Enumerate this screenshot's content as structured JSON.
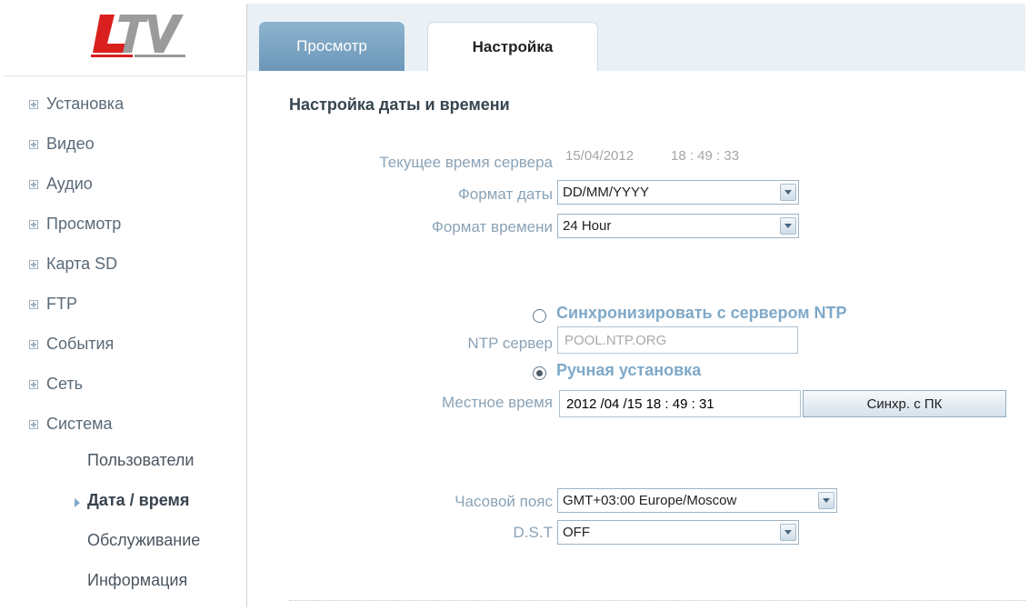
{
  "logo": {
    "text": "LTV"
  },
  "tabs": [
    {
      "label": "Просмотр"
    },
    {
      "label": "Настройка"
    }
  ],
  "sidebar": {
    "items": [
      {
        "label": "Установка"
      },
      {
        "label": "Видео"
      },
      {
        "label": "Аудио"
      },
      {
        "label": "Просмотр"
      },
      {
        "label": "Карта SD"
      },
      {
        "label": "FTP"
      },
      {
        "label": "События"
      },
      {
        "label": "Сеть"
      },
      {
        "label": "Система"
      }
    ],
    "subitems": [
      {
        "label": "Пользователи"
      },
      {
        "label": "Дата / время",
        "active": true
      },
      {
        "label": "Обслуживание"
      },
      {
        "label": "Информация"
      }
    ]
  },
  "main": {
    "title": "Настройка даты и времени",
    "server_time_label": "Текущее время сервера",
    "server_date": "15/04/2012",
    "server_time": "18 : 49 : 33",
    "date_format_label": "Формат даты",
    "date_format_value": "DD/MM/YYYY",
    "time_format_label": "Формат времени",
    "time_format_value": "24 Hour",
    "ntp_sync_label": "Синхронизировать с сервером NTP",
    "ntp_server_label": "NTP сервер",
    "ntp_server_value": "POOL.NTP.ORG",
    "manual_label": "Ручная установка",
    "local_time_label": "Местное время",
    "local_time_value": "2012 /04 /15  18 : 49 : 31",
    "sync_pc_button": "Синхр. с ПК",
    "timezone_label": "Часовой пояс",
    "timezone_value": "GMT+03:00 Europe/Moscow",
    "dst_label": "D.S.T",
    "dst_value": "OFF"
  },
  "colors": {
    "accent": "#7fa9c9",
    "label": "#8aa3b7",
    "tab_active_bg": "#ffffff",
    "tab_inactive_bg": "#7ea6c4",
    "logo_red": "#d9201f"
  }
}
